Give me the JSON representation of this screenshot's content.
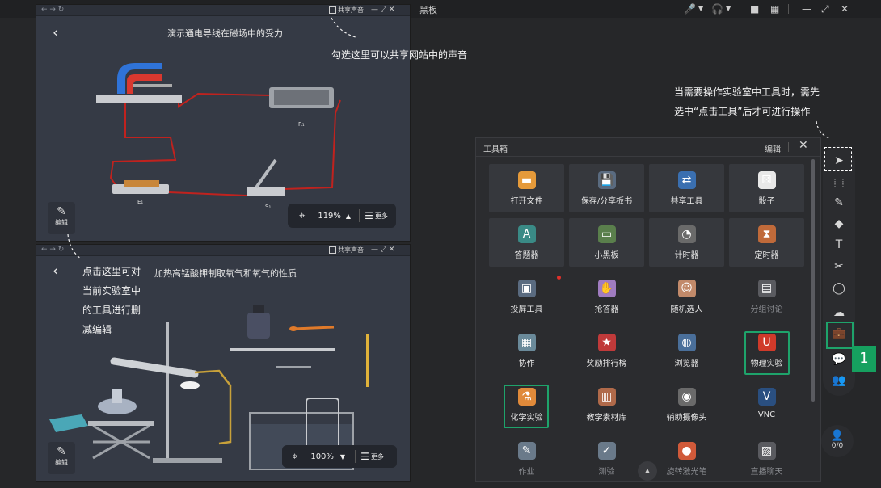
{
  "topbar": {
    "title": "黑板",
    "icons": [
      "mic-muted-icon",
      "speaker-muted-icon",
      "camera-icon",
      "grid-icon",
      "minimize-icon",
      "restore-icon",
      "fullscreen-icon",
      "close-icon"
    ]
  },
  "lab_top": {
    "share_label": "共享声音",
    "title": "演示通电导线在磁场中的受力",
    "r1_label": "R₁",
    "e1_label": "E₁",
    "s1_label": "S₁",
    "edit_label": "编辑",
    "zoom_value": "119%",
    "more_label": "更多"
  },
  "lab_bottom": {
    "share_label": "共享声音",
    "title": "加热高锰酸钾制取氧气和氧气的性质",
    "edit_label": "编辑",
    "zoom_value": "100%",
    "more_label": "更多"
  },
  "annotations": {
    "share_note": "勾选这里可以共享网站中的声音",
    "tool_note_line1": "当需要操作实验室中工具时，需先",
    "tool_note_line2": "选中“点击工具”后才可进行操作",
    "edit_note_line1": "点击这里可对",
    "edit_note_line2": "当前实验室中",
    "edit_note_line3": "的工具进行删",
    "edit_note_line4": "减编辑"
  },
  "toolbox": {
    "title": "工具箱",
    "edit_label": "编辑",
    "tools": [
      {
        "label": "打开文件",
        "icon": "folder-icon"
      },
      {
        "label": "保存/分享板书",
        "icon": "save-icon"
      },
      {
        "label": "共享工具",
        "icon": "share-tool-icon"
      },
      {
        "label": "骰子",
        "icon": "dice-icon"
      },
      {
        "label": "答题器",
        "icon": "answer-icon"
      },
      {
        "label": "小黑板",
        "icon": "blackboard-icon"
      },
      {
        "label": "计时器",
        "icon": "stopwatch-icon"
      },
      {
        "label": "定时器",
        "icon": "hourglass-icon"
      },
      {
        "label": "投屏工具",
        "icon": "cast-icon"
      },
      {
        "label": "抢答器",
        "icon": "buzzer-icon"
      },
      {
        "label": "随机选人",
        "icon": "random-pick-icon"
      },
      {
        "label": "分组讨论",
        "icon": "group-icon"
      },
      {
        "label": "协作",
        "icon": "collab-icon"
      },
      {
        "label": "奖励排行榜",
        "icon": "leaderboard-icon"
      },
      {
        "label": "浏览器",
        "icon": "browser-icon"
      },
      {
        "label": "物理实验",
        "icon": "magnet-icon"
      },
      {
        "label": "化学实验",
        "icon": "flask-icon"
      },
      {
        "label": "教学素材库",
        "icon": "library-icon"
      },
      {
        "label": "辅助摄像头",
        "icon": "webcam-icon"
      },
      {
        "label": "VNC",
        "icon": "vnc-icon"
      },
      {
        "label": "作业",
        "icon": "homework-icon"
      },
      {
        "label": "测验",
        "icon": "quiz-icon"
      },
      {
        "label": "旋转激光笔",
        "icon": "laser-icon"
      },
      {
        "label": "直播聊天",
        "icon": "live-chat-icon"
      }
    ]
  },
  "sidebar": {
    "badge": "1",
    "user_count": "0/0"
  },
  "colors": {
    "highlight": "#1ea36b",
    "badge": "#16a05f"
  }
}
